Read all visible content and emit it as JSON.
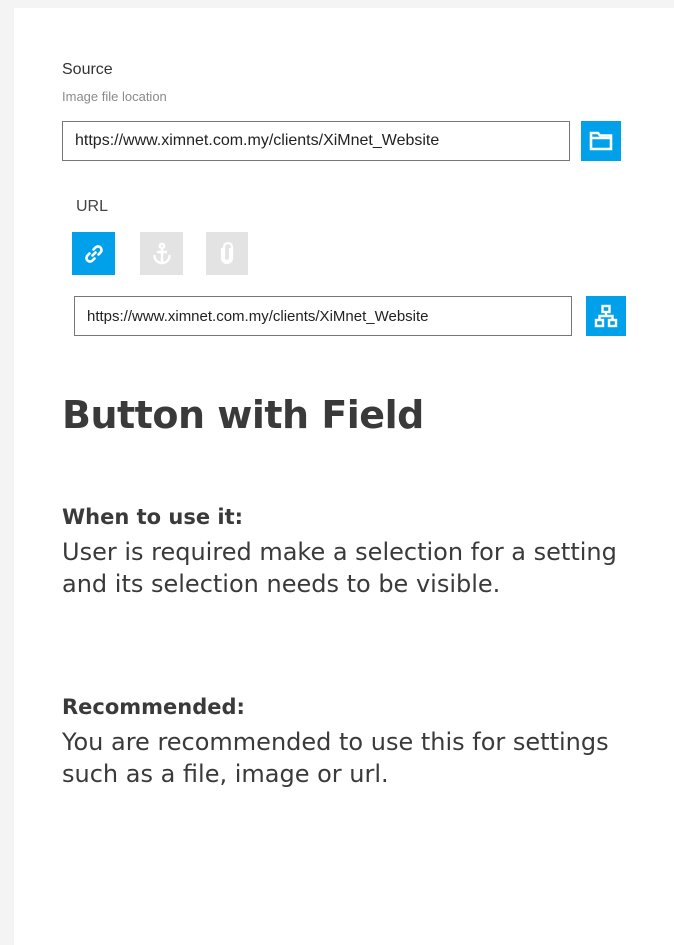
{
  "source": {
    "label": "Source",
    "hint": "Image file location",
    "value": "https://www.ximnet.com.my/clients/XiMnet_Website",
    "browse_icon": "folder-icon"
  },
  "url": {
    "label": "URL",
    "tabs": [
      {
        "name": "link",
        "icon": "link-icon",
        "active": true
      },
      {
        "name": "anchor",
        "icon": "anchor-icon",
        "active": false
      },
      {
        "name": "attachment",
        "icon": "paperclip-icon",
        "active": false
      }
    ],
    "value": "https://www.ximnet.com.my/clients/XiMnet_Website",
    "browse_icon": "sitemap-icon"
  },
  "doc": {
    "heading": "Button with Field",
    "when_title": "When to use it:",
    "when_text": "User is required make a selection for a setting and its selection needs to be visible.",
    "rec_title": "Recommended:",
    "rec_text": "You are recommended to use this for settings such as a file, image or url."
  },
  "colors": {
    "accent": "#00a0ea",
    "inactive_tab": "#e3e3e3",
    "text": "#3a3a3a"
  }
}
